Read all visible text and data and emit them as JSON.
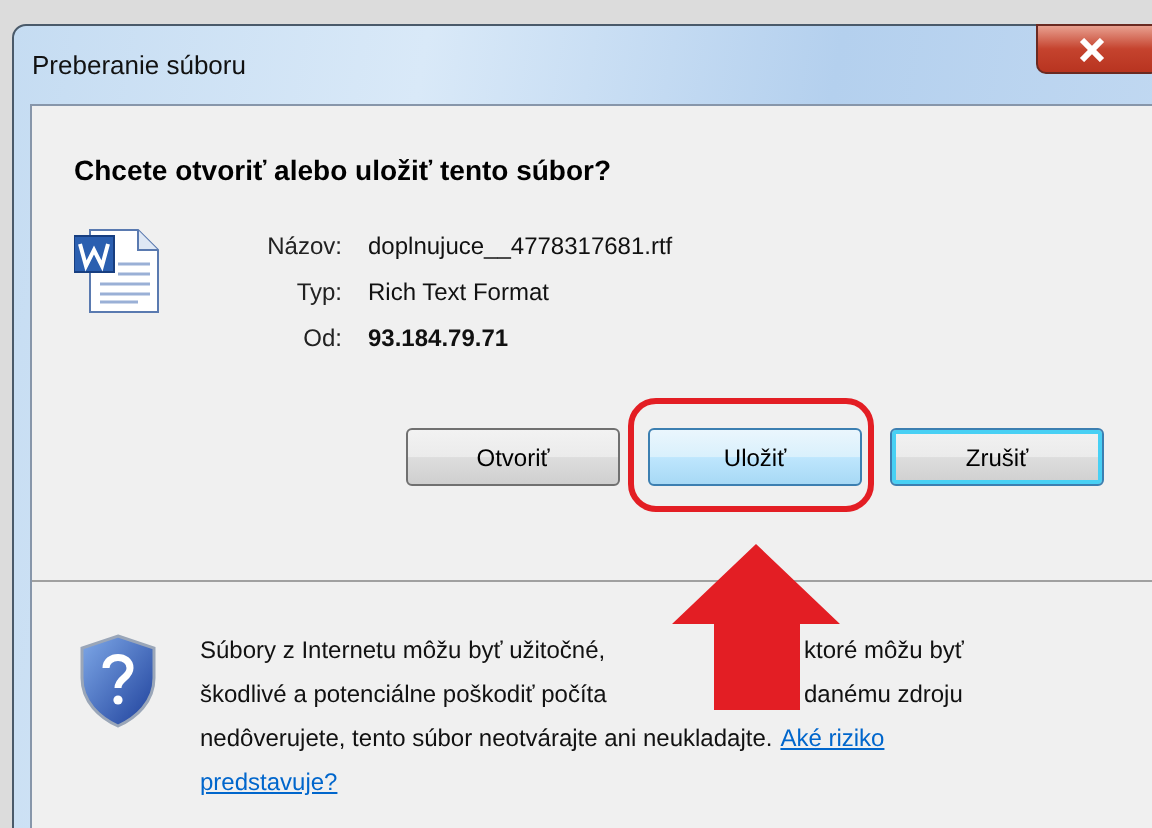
{
  "window": {
    "title": "Preberanie súboru"
  },
  "question": "Chcete otvoriť alebo uložiť tento súbor?",
  "file": {
    "fields": [
      {
        "label": "Názov:",
        "value": "doplnujuce__4778317681.rtf",
        "bold": false
      },
      {
        "label": "Typ:",
        "value": "Rich Text Format",
        "bold": false
      },
      {
        "label": "Od:",
        "value": "93.184.79.71",
        "bold": true
      }
    ]
  },
  "buttons": [
    {
      "label": "Otvoriť",
      "hovered": false,
      "focused": false,
      "circled": false
    },
    {
      "label": "Uložiť",
      "hovered": true,
      "focused": false,
      "circled": true
    },
    {
      "label": "Zrušiť",
      "hovered": false,
      "focused": true,
      "circled": false
    }
  ],
  "annotation": {
    "arrow": true
  },
  "warning": {
    "lines": [
      [
        "Súbory z Internetu môžu byť užitočné,",
        "ktoré môžu byť"
      ],
      [
        "škodlivé a potenciálne poškodiť počíta",
        "danému zdroju"
      ],
      [
        "nedôverujete, tento súbor neotvárajte ani neukladajte."
      ]
    ],
    "link": [
      "Aké riziko",
      "predstavuje?"
    ]
  }
}
